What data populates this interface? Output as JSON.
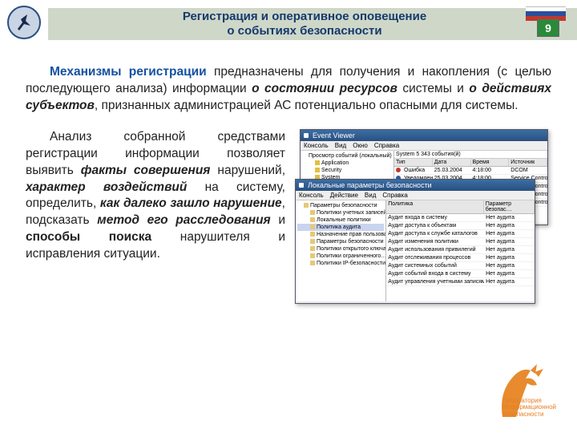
{
  "slide_number": "9",
  "header": {
    "line1": "Регистрация и оперативное оповещение",
    "line2": "о событиях безопасности"
  },
  "para1": {
    "lead": "Механизмы регистрации",
    "t1": " предназначены для получения и накопления (с целью последующего анализа) информации ",
    "b1": "о состоянии ресурсов",
    "t2": " системы и ",
    "b2": "о действиях субъектов",
    "t3": ", признанных администрацией АС потенциально опасными для системы."
  },
  "para2": {
    "t1": "Анализ собранной средствами регистрации информации позволяет выявить ",
    "b1": "факты совершения",
    "t2": " нарушений, ",
    "b2": "характер воздействий",
    "t3": " на систему, определить, ",
    "b3": "как далеко зашло нарушение",
    "t4": ", подсказать ",
    "b4": "метод его расследования",
    "t5": " и ",
    "b5": "способы поиска",
    "t6": " нарушителя и исправления ситуации."
  },
  "win_back": {
    "title": "Event Viewer",
    "menu": [
      "Консоль",
      "Вид",
      "Окно",
      "Справка"
    ],
    "tree_root": "Просмотр событий (локальный)",
    "tree": [
      "Application",
      "Security",
      "System"
    ],
    "list_caption": "System   5 343 события(й)",
    "cols": [
      "Тип",
      "Дата",
      "Время",
      "Источник"
    ],
    "rows": [
      [
        "Ошибка",
        "25.03.2004",
        "4:18:00",
        "DCOM"
      ],
      [
        "Уведомление",
        "25.03.2004",
        "4:18:00",
        "Service Control Manager"
      ],
      [
        "",
        "",
        "",
        "Service Control Manager"
      ],
      [
        "",
        "",
        "",
        "Service Control Manager"
      ],
      [
        "",
        "",
        "",
        "Service Control Manager"
      ],
      [
        "",
        "",
        "",
        "Service Control Manager"
      ]
    ]
  },
  "win_front": {
    "title": "Локальные параметры безопасности",
    "menu": [
      "Консоль",
      "Действие",
      "Вид",
      "Справка"
    ],
    "tree": [
      "Параметры безопасности",
      "Политики учетных записей",
      "Локальные политики",
      "Политика аудита",
      "Назначение прав пользователя",
      "Параметры безопасности",
      "Политики открытого ключа",
      "Политики ограниченного…",
      "Политики IP-безопасности"
    ],
    "cols": [
      "Политика",
      "Параметр безопас…"
    ],
    "rows": [
      [
        "Аудит входа в систему",
        "Нет аудита"
      ],
      [
        "Аудит доступа к объектам",
        "Нет аудита"
      ],
      [
        "Аудит доступа к службе каталогов",
        "Нет аудита"
      ],
      [
        "Аудит изменения политики",
        "Нет аудита"
      ],
      [
        "Аудит использования привилегий",
        "Нет аудита"
      ],
      [
        "Аудит отслеживания процессов",
        "Нет аудита"
      ],
      [
        "Аудит системных событий",
        "Нет аудита"
      ],
      [
        "Аудит событий входа в систему",
        "Нет аудита"
      ],
      [
        "Аудит управления учетными записями",
        "Нет аудита"
      ]
    ]
  },
  "footer_logo": {
    "l1": "Лаборатория",
    "l2": "Информационной",
    "l3": "Безопасности"
  }
}
